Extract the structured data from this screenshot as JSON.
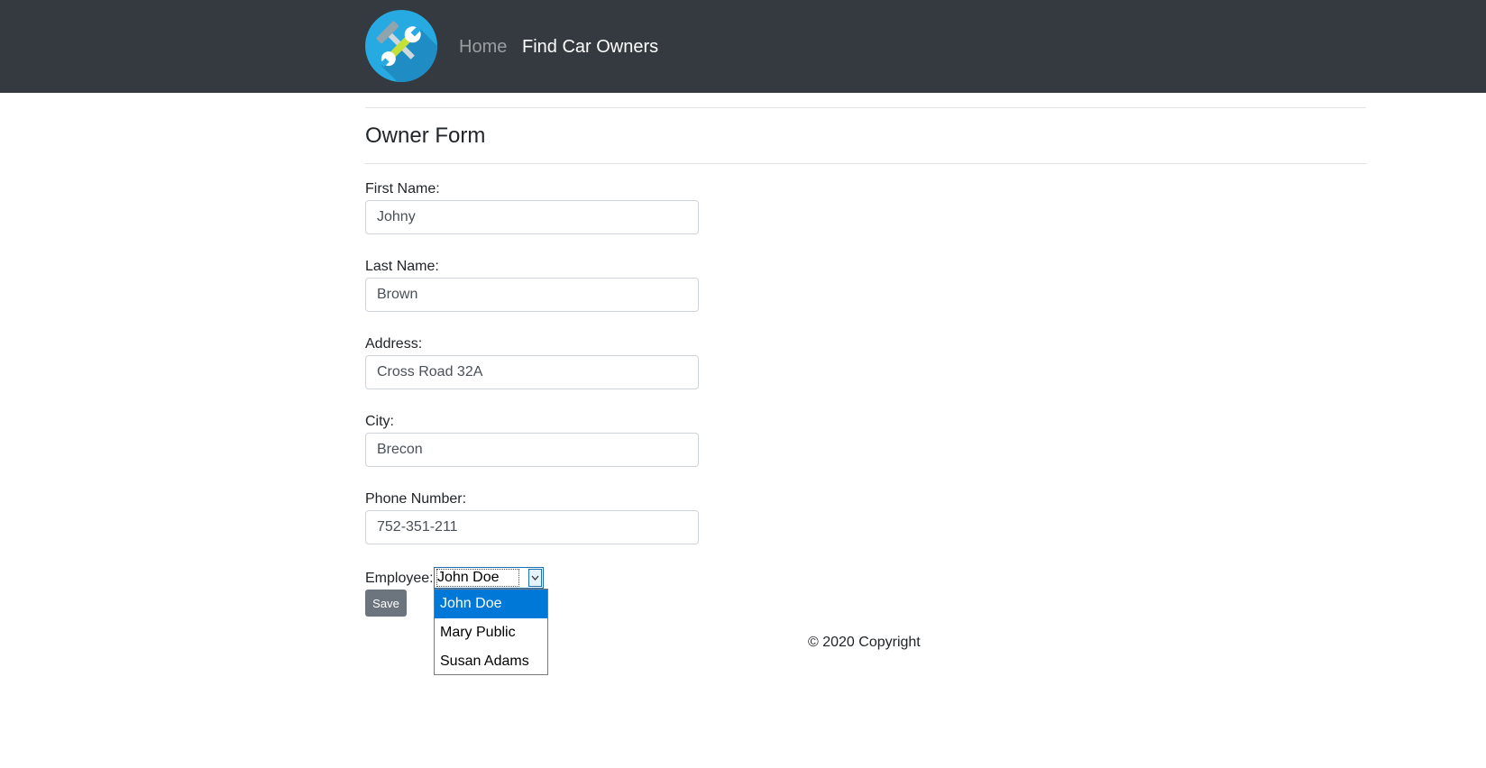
{
  "navbar": {
    "logo_icon": "tools-icon",
    "links": [
      {
        "label": "Home"
      },
      {
        "label": "Find Car Owners"
      }
    ]
  },
  "page": {
    "title": "Owner Form"
  },
  "form": {
    "first_name": {
      "label": "First Name:",
      "value": "Johny"
    },
    "last_name": {
      "label": "Last Name:",
      "value": "Brown"
    },
    "address": {
      "label": "Address:",
      "value": "Cross Road 32A"
    },
    "city": {
      "label": "City:",
      "value": "Brecon"
    },
    "phone": {
      "label": "Phone Number:",
      "value": "752-351-211"
    },
    "employee": {
      "label": "Employee:",
      "selected": "John Doe",
      "options": [
        "John Doe",
        "Mary Public",
        "Susan Adams"
      ]
    },
    "save_label": "Save"
  },
  "footer": {
    "copyright": "© 2020 Copyright"
  },
  "colors": {
    "navbar_bg": "#343a40",
    "logo_bg": "#27a9e1",
    "highlight": "#0078d7",
    "button_bg": "#6c757d"
  }
}
